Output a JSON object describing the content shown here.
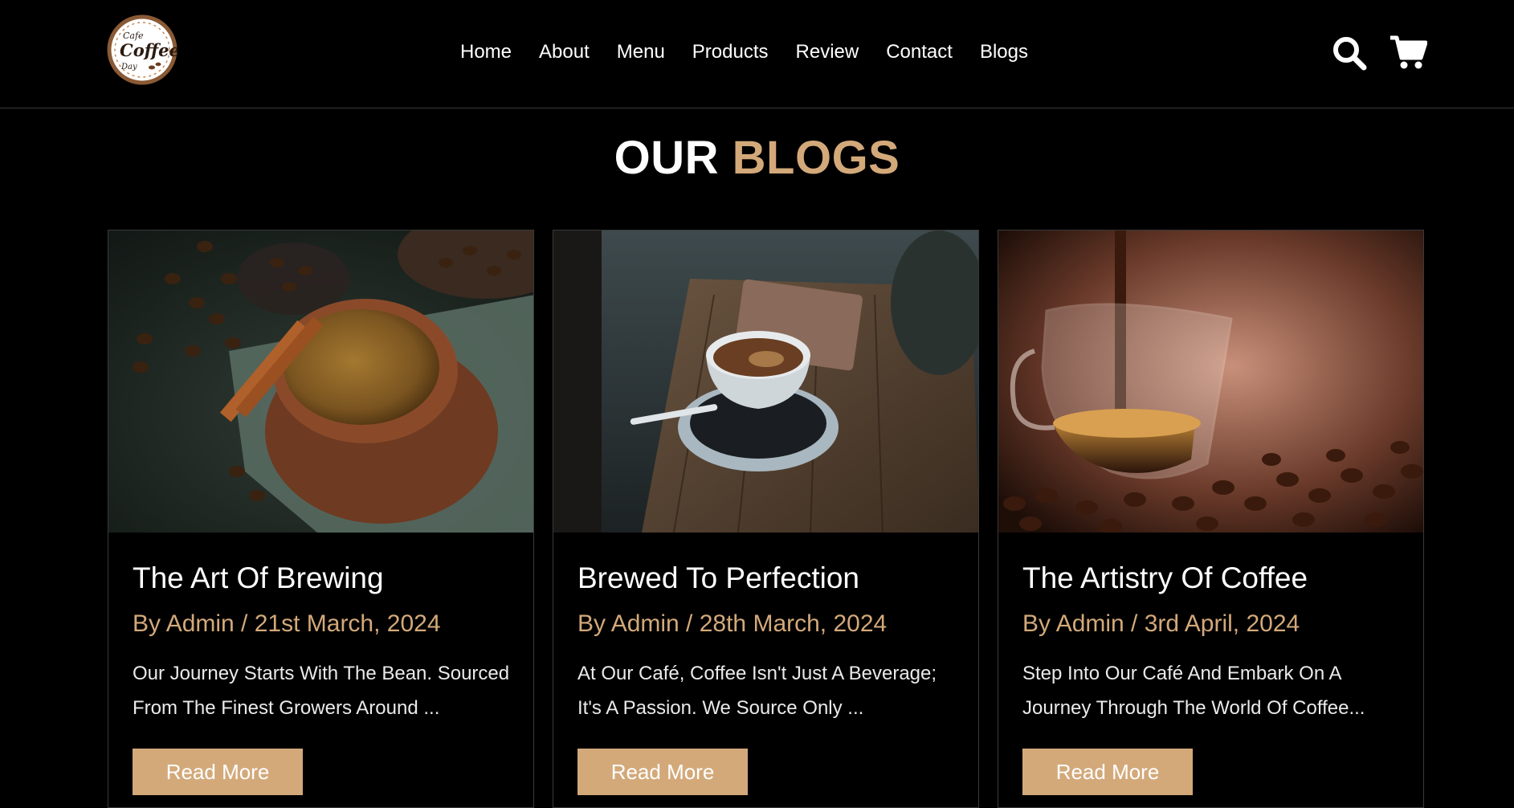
{
  "brand": {
    "logo_lines": [
      "Cafe",
      "Coffee",
      "Day"
    ],
    "accent_color": "#d3a97a",
    "background_color": "#000000"
  },
  "nav": {
    "items": [
      "Home",
      "About",
      "Menu",
      "Products",
      "Review",
      "Contact",
      "Blogs"
    ]
  },
  "header_icons": [
    "search-icon",
    "cart-icon"
  ],
  "section": {
    "title_main": "OUR",
    "title_accent": "BLOGS"
  },
  "blogs": [
    {
      "title": "The Art Of Brewing",
      "meta": "By Admin / 21st March, 2024",
      "excerpt": "Our Journey Starts With The Bean. Sourced From The Finest Growers Around ...",
      "button": "Read More",
      "image": "coffee cup with cinnamon sticks and beans"
    },
    {
      "title": "Brewed To Perfection",
      "meta": "By Admin / 28th March, 2024",
      "excerpt": "At Our Café, Coffee Isn't Just A Beverage; It's A Passion. We Source Only ...",
      "button": "Read More",
      "image": "espresso cup on wooden table"
    },
    {
      "title": "The Artistry Of Coffee",
      "meta": "By Admin / 3rd April, 2024",
      "excerpt": "Step Into Our Café And Embark On A Journey Through The World Of Coffee...",
      "button": "Read More",
      "image": "coffee pouring into glass cup"
    }
  ]
}
